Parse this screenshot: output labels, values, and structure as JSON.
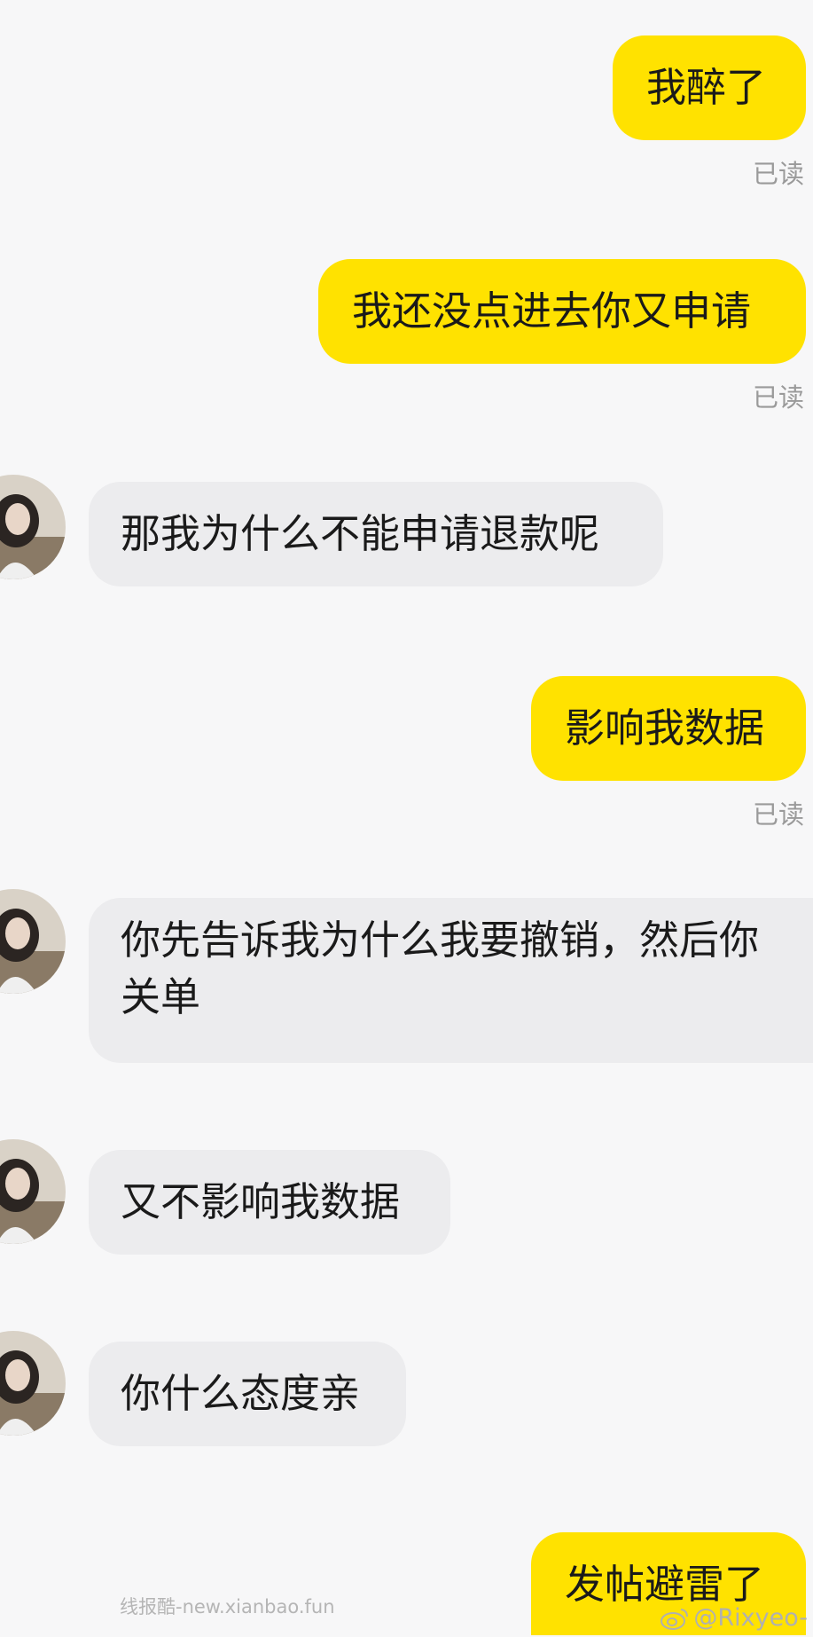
{
  "messages": [
    {
      "from": "me",
      "text": "我醉了",
      "status": "已读"
    },
    {
      "from": "me",
      "text": "我还没点进去你又申请",
      "status": "已读"
    },
    {
      "from": "them",
      "text": "那我为什么不能申请退款呢"
    },
    {
      "from": "me",
      "text": "影响我数据",
      "status": "已读"
    },
    {
      "from": "them",
      "text": "你先告诉我为什么我要撤销，然后你关单"
    },
    {
      "from": "them",
      "text": "又不影响我数据"
    },
    {
      "from": "them",
      "text": "你什么态度亲"
    },
    {
      "from": "me",
      "text": "发帖避雷了"
    }
  ],
  "watermark": "线报酷-new.xianbao.fun",
  "credit": "@Rixyeo-",
  "colors": {
    "outgoing_bubble": "#ffe200",
    "incoming_bubble": "#ececee",
    "background": "#f7f7f8"
  }
}
